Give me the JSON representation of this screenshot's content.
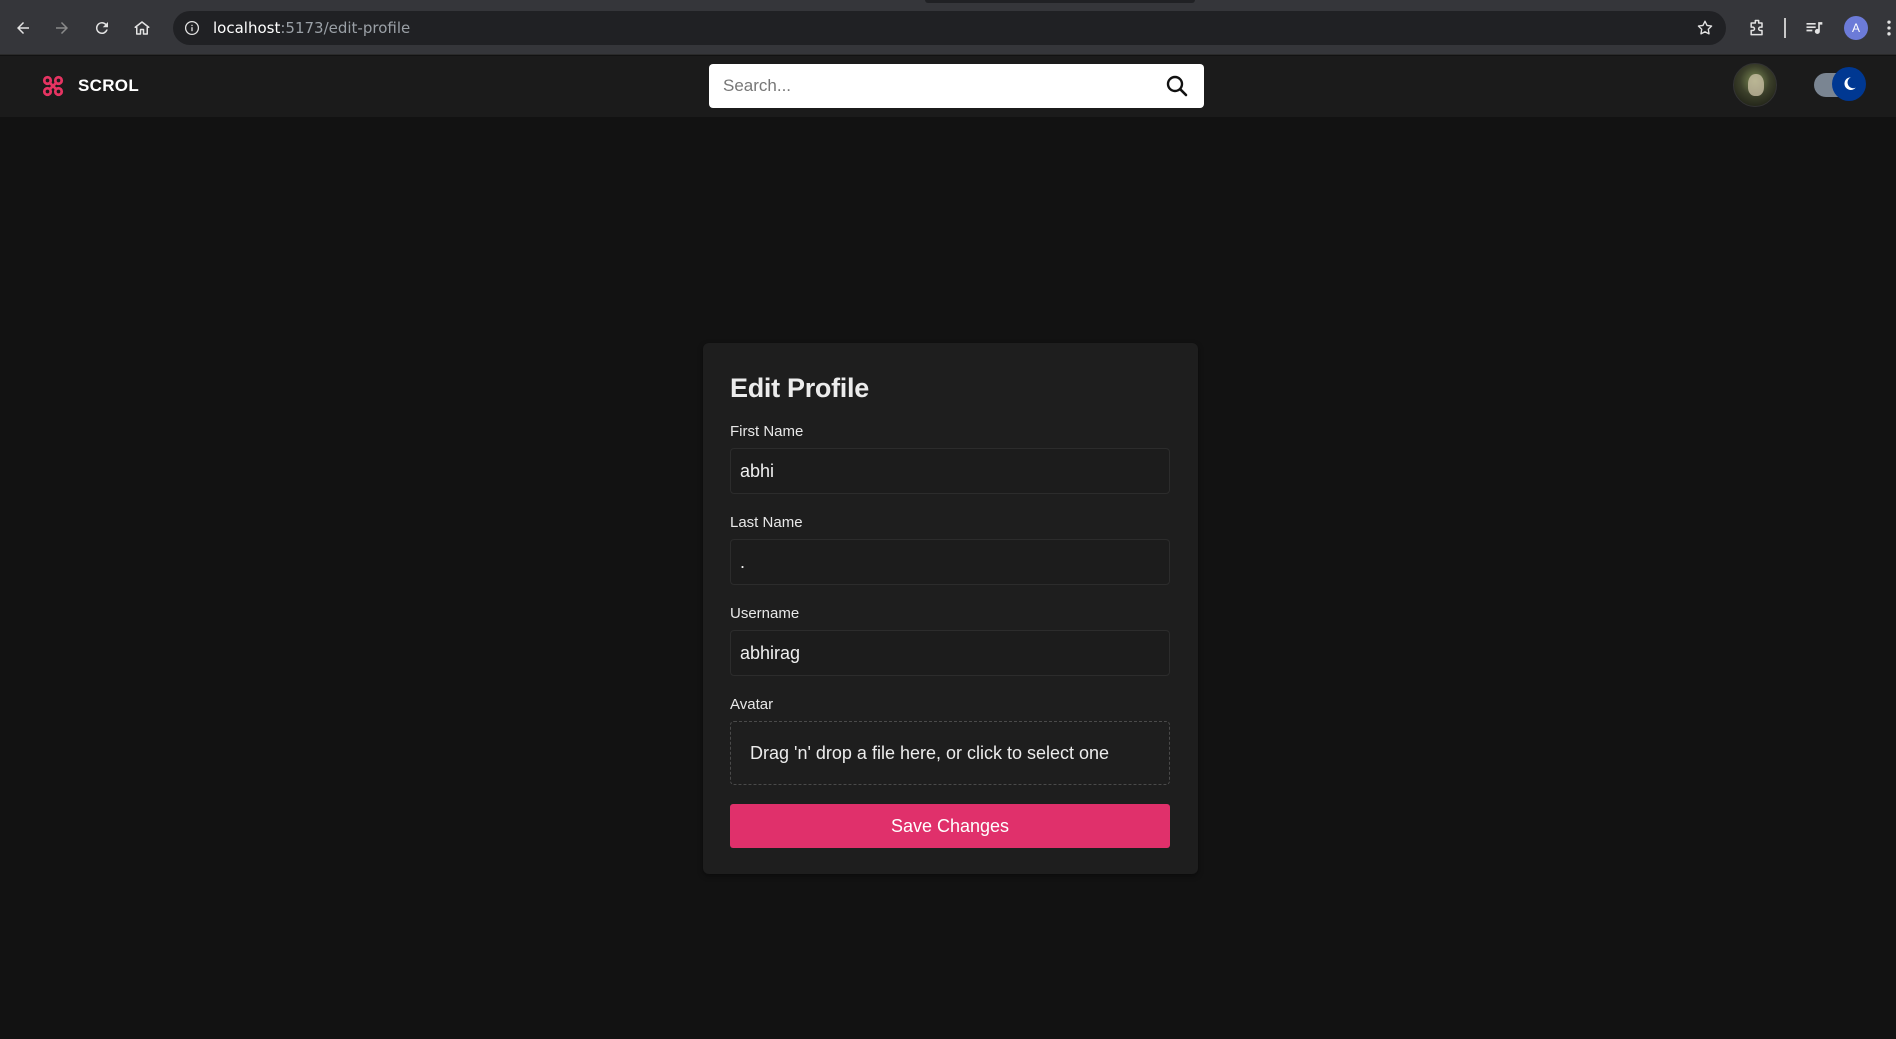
{
  "browser": {
    "url_host": "localhost",
    "url_path": ":5173/edit-profile",
    "profile_initial": "A"
  },
  "header": {
    "brand": "SCROL",
    "search_placeholder": "Search...",
    "theme_mode": "dark"
  },
  "form": {
    "title": "Edit Profile",
    "first_name_label": "First Name",
    "first_name_value": "abhi",
    "last_name_label": "Last Name",
    "last_name_value": ".",
    "username_label": "Username",
    "username_value": "abhirag",
    "avatar_label": "Avatar",
    "dropzone_text": "Drag 'n' drop a file here, or click to select one",
    "save_label": "Save Changes"
  },
  "colors": {
    "accent": "#e0306b",
    "background": "#121212",
    "card": "#1e1e1e",
    "toggle_knob": "#003892"
  }
}
